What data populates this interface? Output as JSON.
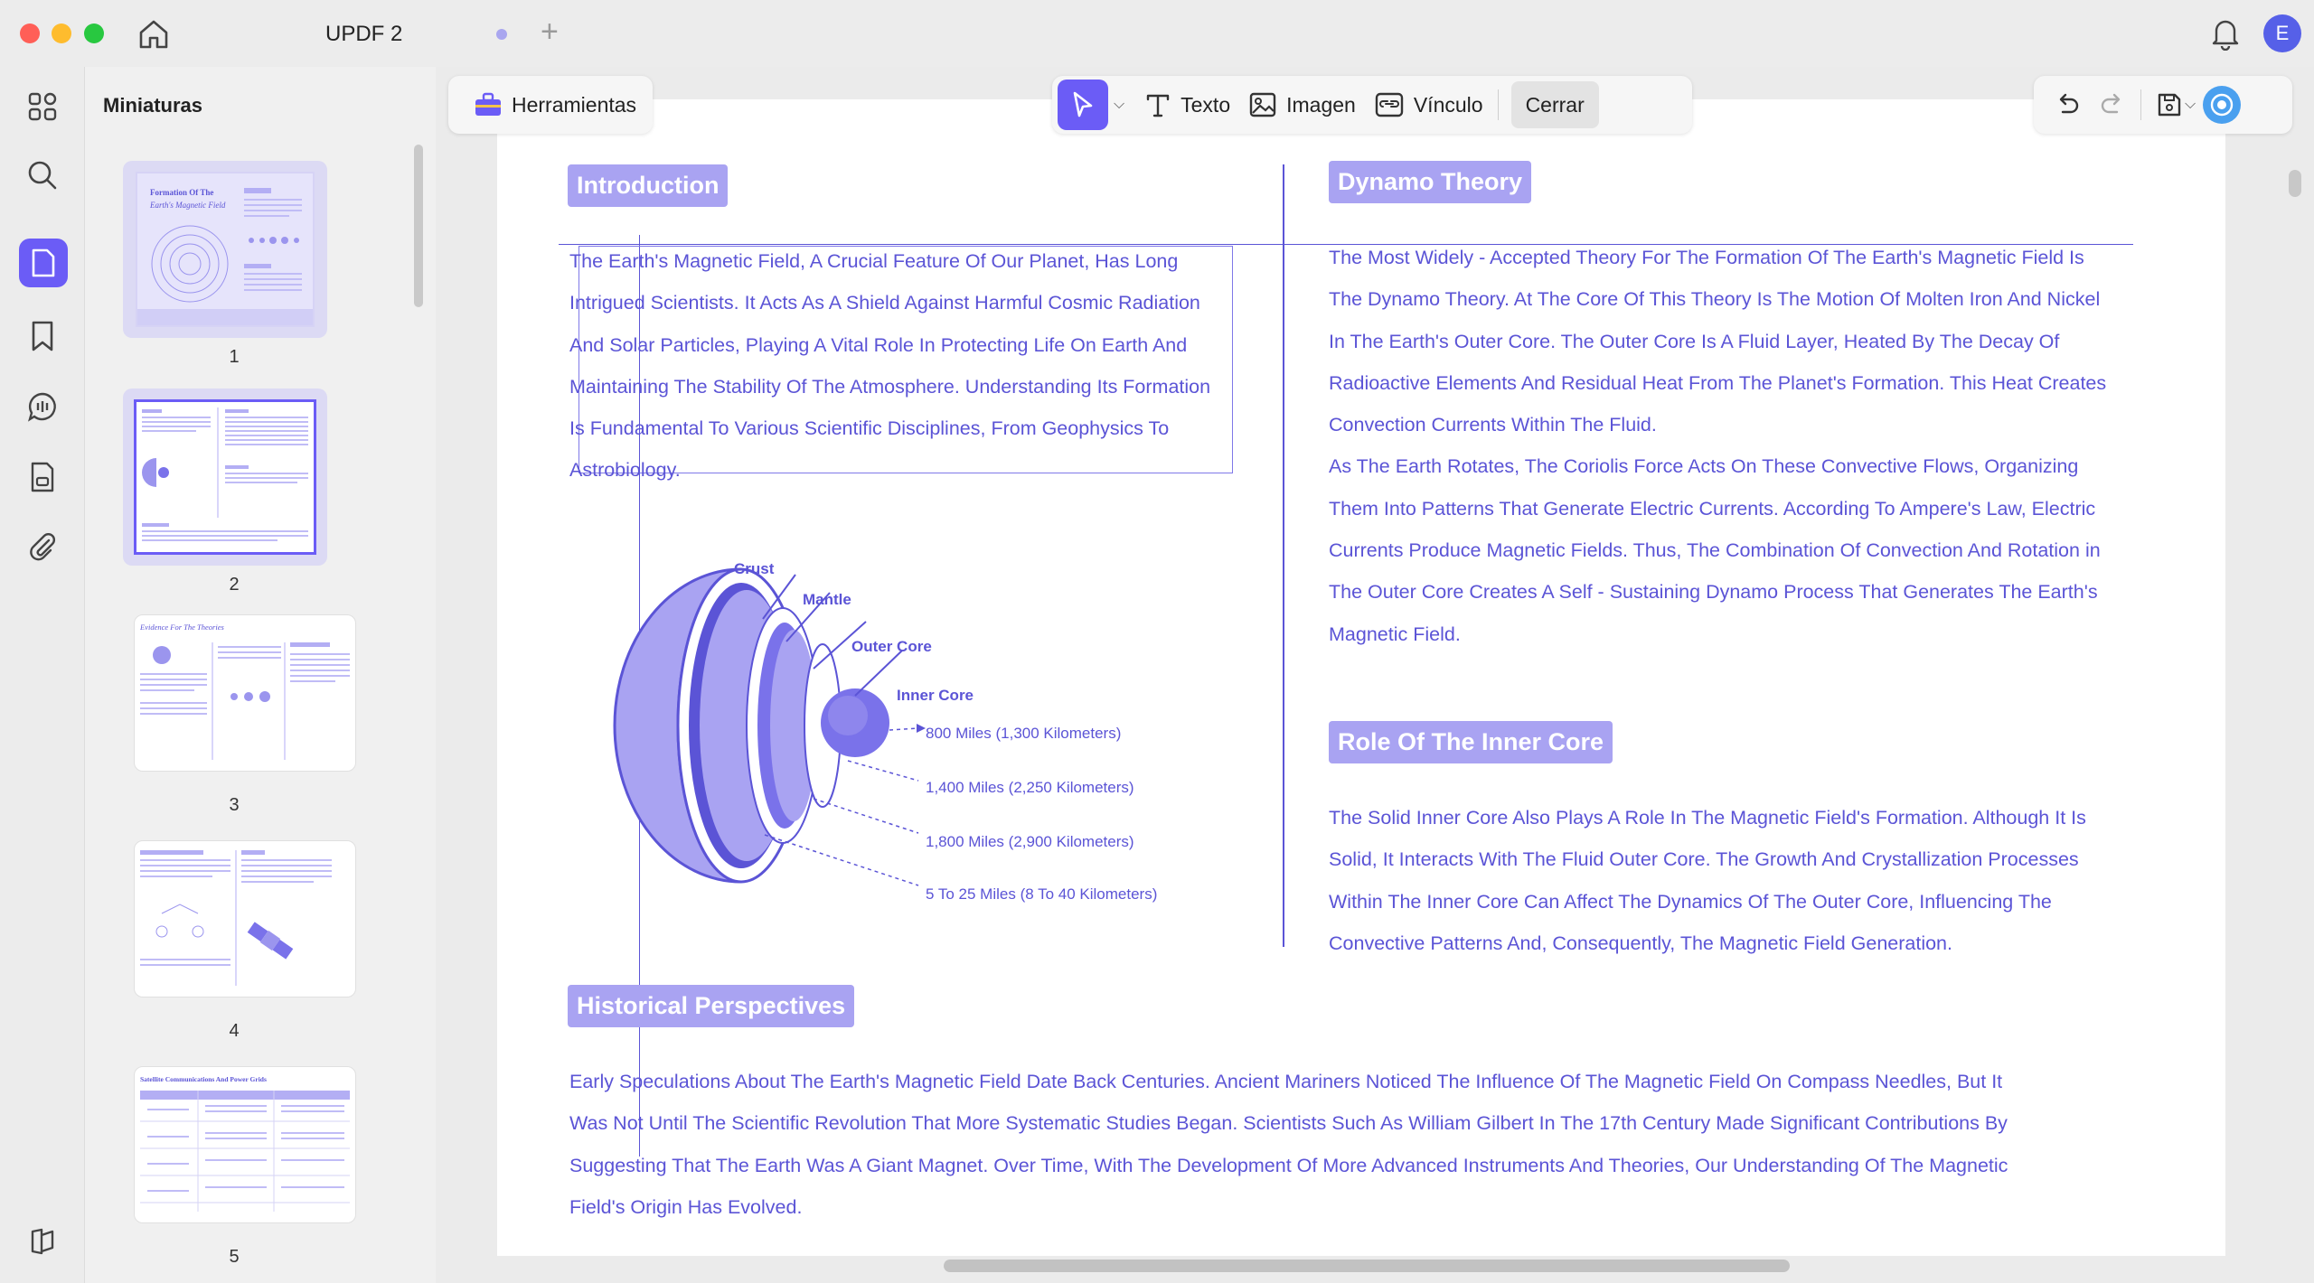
{
  "window": {
    "tab_title": "UPDF 2",
    "tab_add": "+",
    "avatar_initial": "E"
  },
  "thumbnails": {
    "title": "Miniaturas",
    "pages": [
      {
        "number": "1",
        "selected": true
      },
      {
        "number": "2",
        "selected": true
      },
      {
        "number": "3",
        "selected": false
      },
      {
        "number": "4",
        "selected": false
      },
      {
        "number": "5",
        "selected": false
      }
    ],
    "page1_heading": "Formation Of The",
    "page1_subheading": "Earth's Magnetic Field",
    "page3_heading": "Evidence For The Theories",
    "page5_heading": "Satellite Communications And Power Grids"
  },
  "toolbar": {
    "tools_label": "Herramientas",
    "text_label": "Texto",
    "image_label": "Imagen",
    "link_label": "Vínculo",
    "close_label": "Cerrar"
  },
  "document": {
    "introduction": {
      "heading": "Introduction",
      "lines": [
        "The Earth's Magnetic Field, A Crucial Feature Of Our Planet, Has Long",
        "Intrigued Scientists. It Acts As A Shield Against Harmful Cosmic Radiation",
        "And Solar Particles, Playing A Vital Role In Protecting Life On Earth And",
        "Maintaining The Stability Of The Atmosphere. Understanding Its Formation",
        "Is Fundamental To Various Scientific Disciplines, From Geophysics To",
        "Astrobiology."
      ]
    },
    "diagram": {
      "crust": "Crust",
      "mantle": "Mantle",
      "outer_core": "Outer Core",
      "inner_core": "Inner Core",
      "d1": "800 Miles (1,300 Kilometers)",
      "d2": "1,400 Miles (2,250 Kilometers)",
      "d3": "1,800 Miles (2,900 Kilometers)",
      "d4": "5 To 25 Miles (8 To 40 Kilometers)"
    },
    "dynamo": {
      "heading": "Dynamo Theory",
      "lines": [
        "The Most Widely - Accepted Theory For The Formation Of The Earth's Magnetic Field Is",
        "The Dynamo Theory. At The Core Of This Theory Is The Motion Of Molten Iron And Nickel",
        "In The Earth's Outer Core. The Outer Core Is A Fluid Layer, Heated By The Decay Of",
        "Radioactive Elements And Residual Heat From The Planet's Formation. This Heat Creates",
        "Convection Currents Within The Fluid.",
        "As The Earth Rotates, The Coriolis Force Acts On These Convective Flows, Organizing",
        "Them Into Patterns That Generate Electric Currents. According To Ampere's Law, Electric",
        "Currents Produce Magnetic Fields. Thus, The Combination Of Convection And Rotation in",
        "The Outer Core Creates A Self - Sustaining Dynamo Process That Generates The Earth's",
        "Magnetic Field."
      ]
    },
    "inner_core": {
      "heading": "Role Of The Inner Core",
      "lines": [
        "The Solid Inner Core Also Plays A Role In The Magnetic Field's Formation. Although It Is",
        "Solid, It Interacts With The Fluid Outer Core. The Growth And Crystallization Processes",
        "Within The Inner Core Can Affect The Dynamics Of The Outer Core, Influencing The",
        "Convective Patterns And, Consequently, The Magnetic Field Generation."
      ]
    },
    "historical": {
      "heading": "Historical Perspectives",
      "lines": [
        "Early Speculations About The Earth's Magnetic Field Date Back Centuries. Ancient Mariners Noticed The Influence Of The Magnetic Field On Compass Needles, But It",
        "Was Not Until The Scientific Revolution That More Systematic Studies Began. Scientists Such As William Gilbert In The 17th Century Made Significant Contributions By",
        "Suggesting That The Earth Was A Giant Magnet. Over Time, With The Development Of More Advanced Instruments And Theories, Our Understanding Of The Magnetic",
        "Field's Origin Has Evolved."
      ]
    }
  },
  "colors": {
    "accent": "#6b5cf6",
    "doc_text": "#5b54d6",
    "badge": "#a9a3f2"
  }
}
